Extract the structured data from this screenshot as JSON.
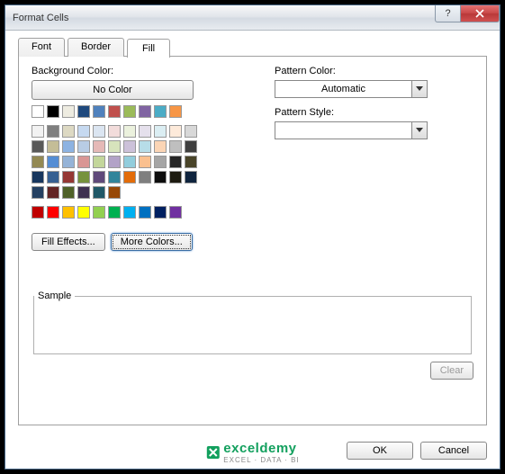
{
  "window": {
    "title": "Format Cells"
  },
  "tabs": {
    "font": "Font",
    "border": "Border",
    "fill": "Fill"
  },
  "fill": {
    "bg_label": "Background Color:",
    "no_color": "No Color",
    "fill_effects": "Fill Effects...",
    "more_colors": "More Colors...",
    "row_top": [
      "#ffffff",
      "#000000",
      "#eeece1",
      "#1f497d",
      "#4f81bd",
      "#c0504d",
      "#9bbb59",
      "#8064a2",
      "#4bacc6",
      "#f79646"
    ],
    "theme_rows": [
      [
        "#f2f2f2",
        "#7f7f7f",
        "#ddd9c3",
        "#c6d9f0",
        "#dbe5f1",
        "#f2dcdb",
        "#ebf1dd",
        "#e5e0ec",
        "#dbeef3",
        "#fdeada"
      ],
      [
        "#d8d8d8",
        "#595959",
        "#c4bd97",
        "#8db3e2",
        "#b8cce4",
        "#e5b9b7",
        "#d7e3bc",
        "#ccc1d9",
        "#b7dde8",
        "#fbd5b5"
      ],
      [
        "#bfbfbf",
        "#3f3f3f",
        "#938953",
        "#548dd4",
        "#95b3d7",
        "#d99694",
        "#c3d69b",
        "#b2a2c7",
        "#92cddc",
        "#fac08f"
      ],
      [
        "#a5a5a5",
        "#262626",
        "#494429",
        "#17365d",
        "#366092",
        "#953734",
        "#76923c",
        "#5f497a",
        "#31859b",
        "#e36c09"
      ],
      [
        "#7f7f7f",
        "#0c0c0c",
        "#1d1b10",
        "#0f243e",
        "#244061",
        "#632423",
        "#4f6128",
        "#3f3151",
        "#205867",
        "#974806"
      ]
    ],
    "row_std": [
      "#c00000",
      "#ff0000",
      "#ffc000",
      "#ffff00",
      "#92d050",
      "#00b050",
      "#00b0f0",
      "#0070c0",
      "#002060",
      "#7030a0"
    ]
  },
  "pattern": {
    "color_label": "Pattern Color:",
    "color_value": "Automatic",
    "style_label": "Pattern Style:",
    "style_value": ""
  },
  "sample": {
    "label": "Sample"
  },
  "buttons": {
    "clear": "Clear",
    "ok": "OK",
    "cancel": "Cancel"
  },
  "watermark": {
    "brand": "exceldemy",
    "sub": "EXCEL · DATA · BI"
  }
}
